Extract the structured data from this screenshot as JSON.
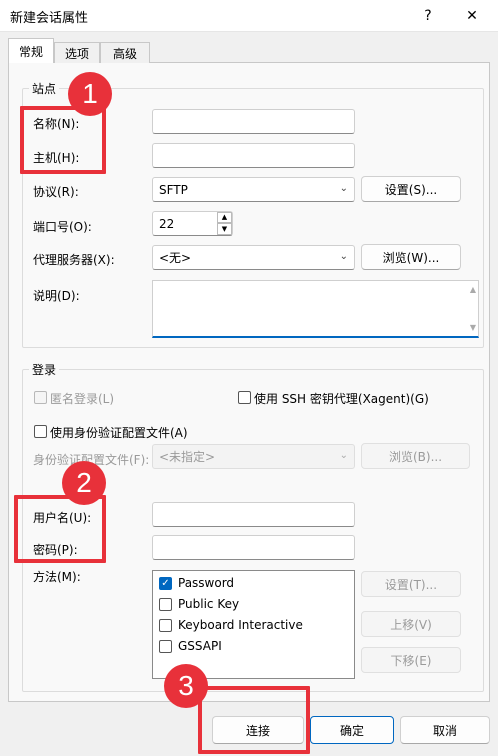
{
  "window": {
    "title": "新建会话属性",
    "help": "?",
    "close": "✕"
  },
  "tabs": [
    {
      "label": "常规"
    },
    {
      "label": "选项"
    },
    {
      "label": "高级"
    }
  ],
  "site": {
    "group_label": "站点",
    "name_label": "名称(N):",
    "host_label": "主机(H):",
    "protocol_label": "协议(R):",
    "protocol_value": "SFTP",
    "settings_button": "设置(S)...",
    "port_label": "端口号(O):",
    "port_value": "22",
    "proxy_label": "代理服务器(X):",
    "proxy_value": "<无>",
    "browse_button": "浏览(W)...",
    "desc_label": "说明(D):"
  },
  "login": {
    "group_label": "登录",
    "anonymous_label": "匿名登录(L)",
    "ssh_agent_label": "使用 SSH 密钥代理(Xagent)(G)",
    "auth_profile_label": "使用身份验证配置文件(A)",
    "auth_file_label": "身份验证配置文件(F):",
    "auth_file_value": "<未指定>",
    "auth_browse_button": "浏览(B)...",
    "username_label": "用户名(U):",
    "password_label": "密码(P):",
    "method_label": "方法(M):",
    "methods": [
      {
        "label": "Password",
        "checked": true
      },
      {
        "label": "Public Key",
        "checked": false
      },
      {
        "label": "Keyboard Interactive",
        "checked": false
      },
      {
        "label": "GSSAPI",
        "checked": false
      }
    ],
    "method_settings_button": "设置(T)...",
    "move_up_button": "上移(V)",
    "move_down_button": "下移(E)"
  },
  "footer": {
    "connect": "连接",
    "ok": "确定",
    "cancel": "取消"
  },
  "annotations": {
    "badge1": "1",
    "badge2": "2",
    "badge3": "3",
    "color": "#e8313a"
  }
}
